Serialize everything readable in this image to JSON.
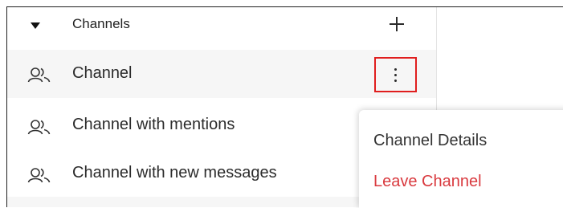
{
  "section": {
    "title": "Channels",
    "icons": {
      "collapse": "caret-down-icon",
      "add": "plus-icon"
    }
  },
  "channels": [
    {
      "label": "Channel",
      "icon": "users-icon"
    },
    {
      "label": "Channel with mentions",
      "icon": "users-icon"
    },
    {
      "label": "Channel with new messages",
      "icon": "users-icon"
    }
  ],
  "channel_options_icon": "more-vertical-icon",
  "menu": {
    "items": [
      {
        "label": "Channel Details"
      },
      {
        "label": "Leave Channel"
      }
    ]
  },
  "colors": {
    "danger": "#d93a3f",
    "highlight_border": "#e01e1e",
    "active_row": "#f6f6f6",
    "text": "#2b2b2b"
  }
}
